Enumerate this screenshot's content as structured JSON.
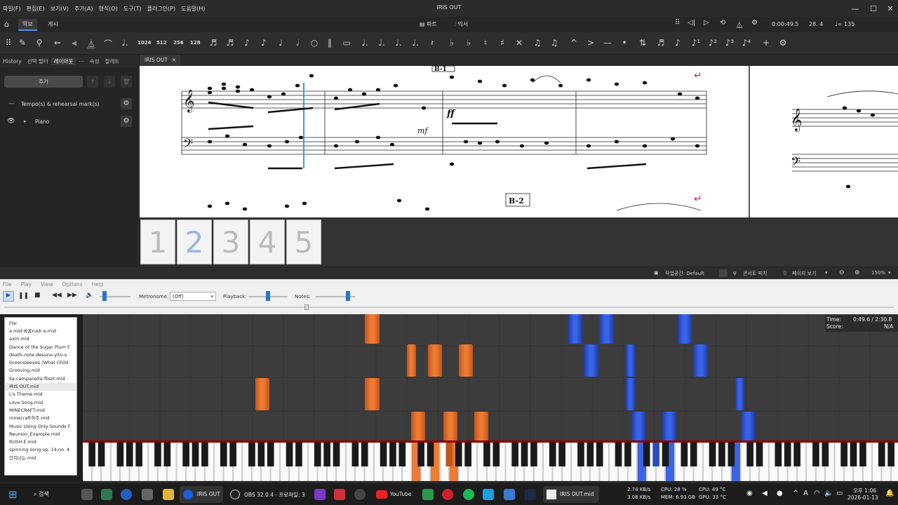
{
  "window": {
    "title": "IRIS OUT",
    "menu": [
      "파일(F)",
      "편집(E)",
      "보기(V)",
      "추가(A)",
      "형식(O)",
      "도구(T)",
      "플러그인(P)",
      "도움말(H)"
    ]
  },
  "tabs": {
    "home_icon": "home-icon",
    "score_tab": "악보",
    "publish_tab": "게시",
    "parts": "파트",
    "mixer": "믹서"
  },
  "playback": {
    "time": "0:00:49.5",
    "measure": "28. 4",
    "tempo": "♩= 135"
  },
  "toolbar": {
    "durations": [
      "1024",
      "512",
      "256",
      "128"
    ]
  },
  "left_panel": {
    "tabs": [
      "History",
      "선택 필터",
      "레이아웃",
      "⋯",
      "속성",
      "팔레트"
    ],
    "add_label": "추가",
    "rows": [
      {
        "label": "Tempo(s) & rehearsal mark(s)"
      },
      {
        "label": "Piano"
      }
    ]
  },
  "score": {
    "tab_label": "IRIS OUT",
    "rehearsal": [
      "B-1",
      "B-2"
    ],
    "dynamics": [
      "ff",
      "mf"
    ],
    "pages": [
      "1",
      "2",
      "3",
      "4",
      "5"
    ]
  },
  "statusbar": {
    "workspace": "작업공간: Default",
    "concert_pitch": "콘서트 피치",
    "page_view": "페이지 보기",
    "zoom": "150%"
  },
  "player": {
    "menu": [
      "File",
      "Play",
      "View",
      "Options",
      "Help"
    ],
    "metronome_label": "Metronome:",
    "metronome_value": "(Off)",
    "playback_label": "Playback:",
    "notes_label": "Notes:",
    "time_label": "Time:",
    "time_value": "0:49.6 / 2:30.8",
    "score_label": "Score:",
    "score_value": "N/A",
    "file_header": "File",
    "files": [
      "a mid 바꿈rush e.mid",
      "axm.mid",
      "Dance of the Sugar Plum F",
      "death-note-desuno-yito-s",
      "Greensleeves (What Child",
      "Grooving.mid",
      "lla-campanella-fliszt.mid",
      "IRIS OUT.mid",
      "L's Theme.mid",
      "Love Song.mid",
      "MINECRAFT.mid",
      "minecraft하주.mid",
      "Music Using Only Sounds F",
      "Reunion_Example.mid",
      "RUSH E.mid",
      "spinning song op. 14,no. 4",
      "간지나는.mid"
    ]
  },
  "taskbar": {
    "search": "검색",
    "items": [
      "IRIS OUT",
      "OBS 32.0.4 - 프로파일: 3",
      "YouTube",
      "IRIS OUT.mid"
    ],
    "net_up": "2.74 KB/s",
    "net_down": "3.08 KB/s",
    "cpu": "CPU: 28 %",
    "mem": "MEM: 6.93 GB",
    "cpu_temp": "CPU: 49 °C",
    "gpu_temp": "GPU: 33 °C",
    "clock_time": "오후 1:06",
    "clock_date": "2026-01-13"
  }
}
